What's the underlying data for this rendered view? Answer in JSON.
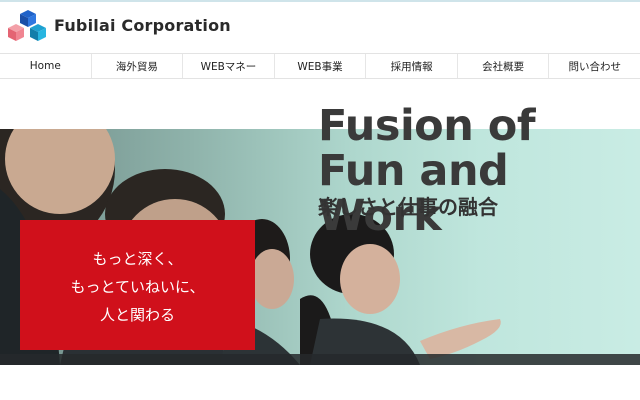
{
  "brand": {
    "name": "Fubilai Corporation"
  },
  "nav": {
    "items": [
      {
        "label": "Home"
      },
      {
        "label": "海外貿易"
      },
      {
        "label": "WEBマネー"
      },
      {
        "label": "WEB事業"
      },
      {
        "label": "採用情報"
      },
      {
        "label": "会社概要"
      },
      {
        "label": "問い合わせ"
      }
    ]
  },
  "hero": {
    "headline_line1": "Fusion of",
    "headline_line2": "Fun and Work",
    "subheadline": "楽しさと仕事の融合",
    "tagline": [
      "もっと深く、",
      "もっとていねいに、",
      "人と関わる"
    ]
  },
  "colors": {
    "accent_red": "#d0101b",
    "hero_bg": "#aed7cd",
    "text_dark": "#3a3a3a"
  }
}
